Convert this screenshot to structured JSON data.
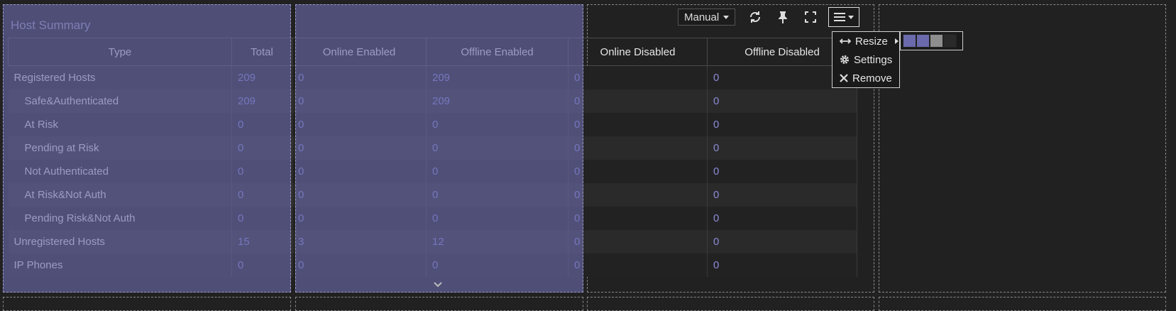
{
  "widget": {
    "title": "Host Summary",
    "refresh_mode": "Manual",
    "columns": [
      "Type",
      "Total",
      "Online Enabled",
      "Offline Enabled",
      "Online Disabled",
      "Offline Disabled"
    ],
    "rows": [
      {
        "type": "Registered Hosts",
        "indent": false,
        "values": [
          "209",
          "0",
          "209",
          "0",
          "0"
        ]
      },
      {
        "type": "Safe&Authenticated",
        "indent": true,
        "values": [
          "209",
          "0",
          "209",
          "0",
          "0"
        ]
      },
      {
        "type": "At Risk",
        "indent": true,
        "values": [
          "0",
          "0",
          "0",
          "0",
          "0"
        ]
      },
      {
        "type": "Pending at Risk",
        "indent": true,
        "values": [
          "0",
          "0",
          "0",
          "0",
          "0"
        ]
      },
      {
        "type": "Not Authenticated",
        "indent": true,
        "values": [
          "0",
          "0",
          "0",
          "0",
          "0"
        ]
      },
      {
        "type": "At Risk&Not Auth",
        "indent": true,
        "values": [
          "0",
          "0",
          "0",
          "0",
          "0"
        ]
      },
      {
        "type": "Pending Risk&Not Auth",
        "indent": true,
        "values": [
          "0",
          "0",
          "0",
          "0",
          "0"
        ]
      },
      {
        "type": "Unregistered Hosts",
        "indent": false,
        "values": [
          "15",
          "3",
          "12",
          "0",
          "0"
        ]
      },
      {
        "type": "IP Phones",
        "indent": false,
        "values": [
          "0",
          "0",
          "0",
          "0",
          "0"
        ]
      }
    ]
  },
  "menu": {
    "items": [
      {
        "label": "Resize",
        "icon": "resize-icon"
      },
      {
        "label": "Settings",
        "icon": "gear-icon"
      },
      {
        "label": "Remove",
        "icon": "close-icon"
      }
    ],
    "resize_swatch_colors": [
      "#6a6aac",
      "#6a6aac",
      "#8e8e8e",
      "#2a2a2a"
    ]
  },
  "colors": {
    "accent_number": "#8a8ad8",
    "selection_overlay": "#6a6aac"
  }
}
